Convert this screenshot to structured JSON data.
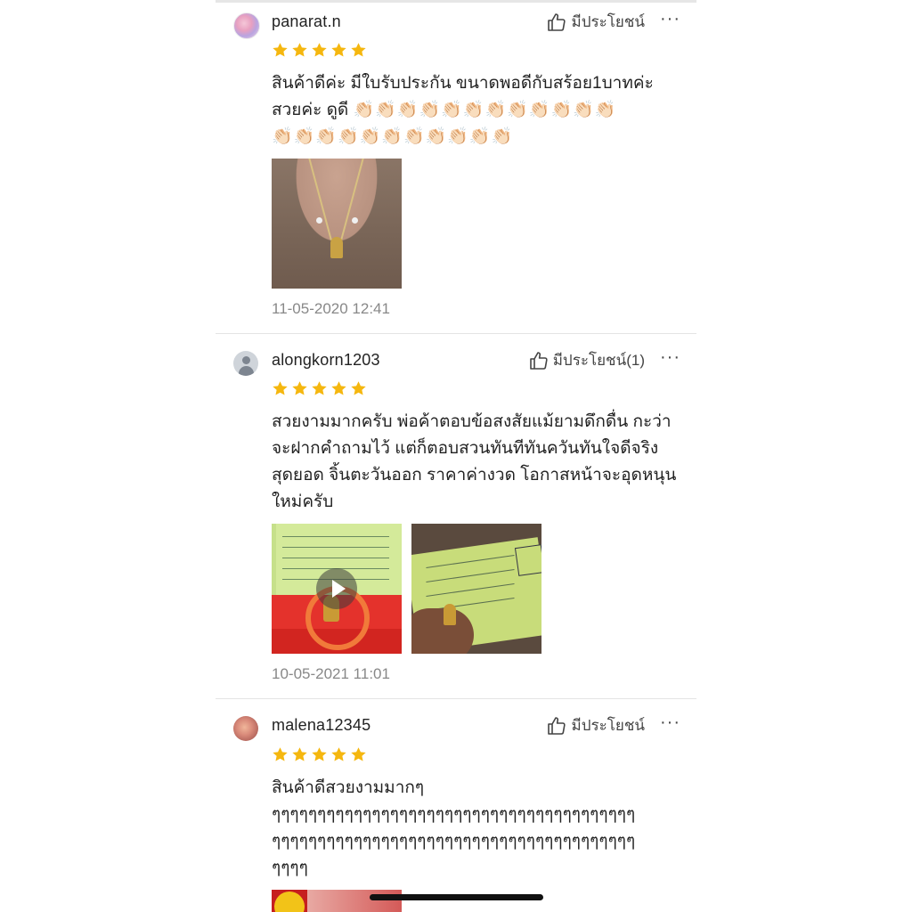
{
  "actions": {
    "helpful_label": "มีประโยชน์",
    "more_label": "···"
  },
  "reviews": [
    {
      "username": "panarat.n",
      "rating": 5,
      "helpful_text": "มีประโยชน์",
      "lines": [
        "สินค้าดีค่ะ มีใบรับประกัน ขนาดพอดีกับสร้อย1บาทค่ะ",
        "สวยค่ะ ดูดี "
      ],
      "claps_line2": "👏🏻👏🏻👏🏻👏🏻👏🏻👏🏻👏🏻👏🏻👏🏻👏🏻👏🏻👏🏻",
      "claps_line3": "👏🏻👏🏻👏🏻👏🏻👏🏻👏🏻👏🏻👏🏻👏🏻👏🏻👏🏻",
      "date": "11-05-2020 12:41"
    },
    {
      "username": "alongkorn1203",
      "rating": 5,
      "helpful_text": "มีประโยชน์(1)",
      "lines": [
        "สวยงามมากครับ พ่อค้าตอบข้อสงสัยแม้ยามดึกดื่น กะว่า",
        "จะฝากคำถามไว้ แต่ก็ตอบสวนทันทีทันควันทันใจดีจริง",
        "สุดยอด จิ้นตะวันออก ราคาค่างวด โอกาสหน้าจะอุดหนุน",
        "ใหม่ครับ"
      ],
      "date": "10-05-2021 11:01"
    },
    {
      "username": "malena12345",
      "rating": 5,
      "helpful_text": "มีประโยชน์",
      "lines": [
        "สินค้าดีสวยงามมากๆ",
        "ๆๆๆๆๆๆๆๆๆๆๆๆๆๆๆๆๆๆๆๆๆๆๆๆๆๆๆๆๆๆๆๆๆๆๆๆๆๆๆๆ",
        "ๆๆๆๆๆๆๆๆๆๆๆๆๆๆๆๆๆๆๆๆๆๆๆๆๆๆๆๆๆๆๆๆๆๆๆๆๆๆๆๆ",
        "ๆๆๆๆ"
      ]
    }
  ],
  "colors": {
    "star": "#f5b70f",
    "text": "#222222",
    "muted": "#888888",
    "divider": "#e4e4e4"
  }
}
